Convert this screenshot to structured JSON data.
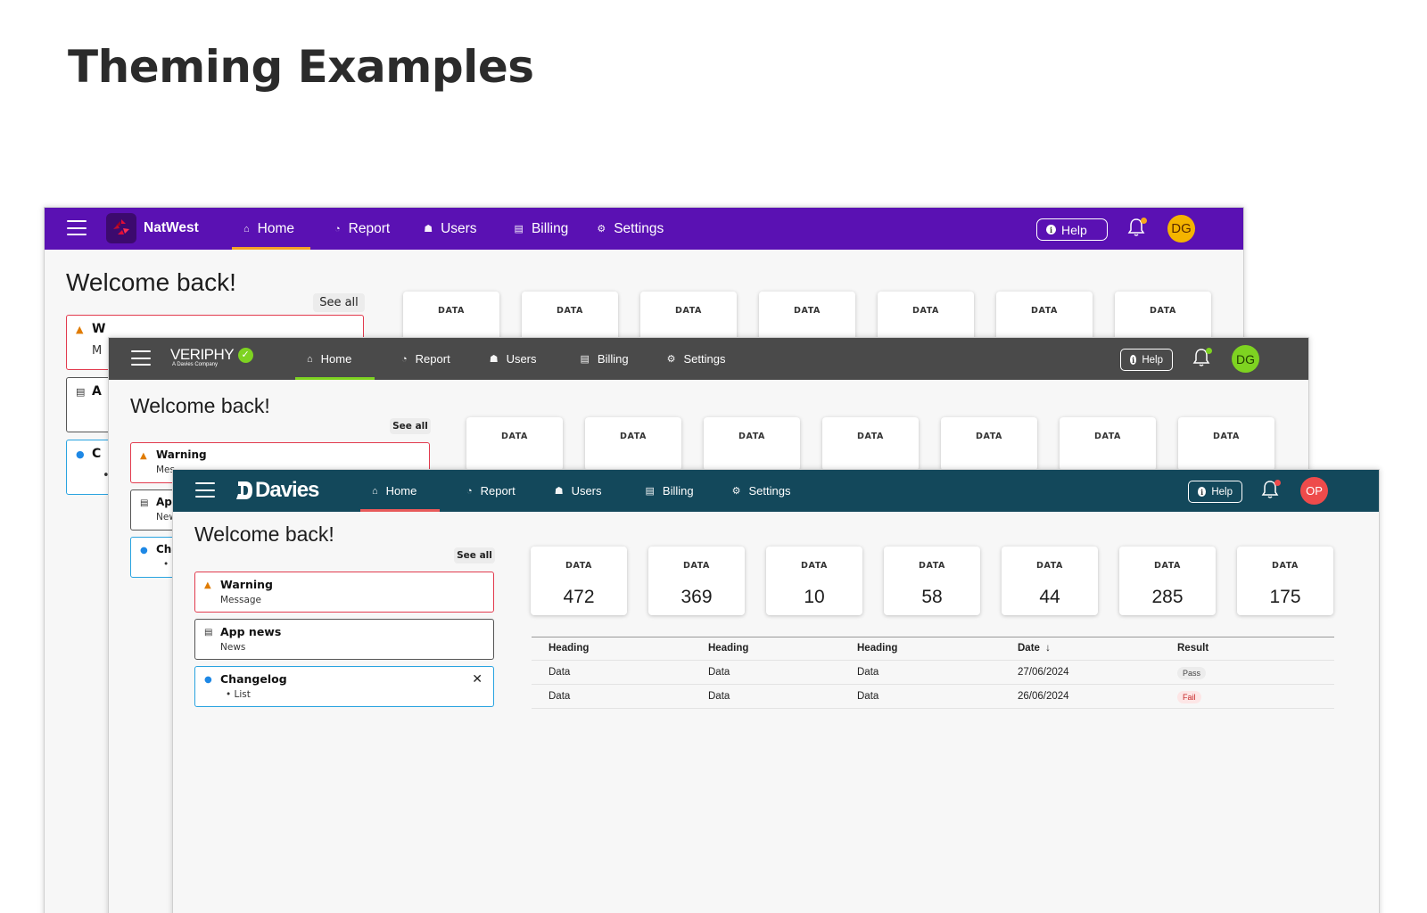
{
  "page": {
    "title": "Theming Examples"
  },
  "themes": {
    "natwest": {
      "brand_name": "NatWest",
      "colors": {
        "header": "#5a11b3",
        "accent": "#f4a228",
        "avatar": "#f4b400",
        "bell_dot": "#f7a81b"
      },
      "nav": [
        {
          "label": "Home",
          "icon": "home-icon",
          "glyph": "⌂"
        },
        {
          "label": "Report",
          "icon": "report-icon",
          "glyph": "◔"
        },
        {
          "label": "Users",
          "icon": "users-icon",
          "glyph": "☗"
        },
        {
          "label": "Billing",
          "icon": "billing-icon",
          "glyph": "▤"
        },
        {
          "label": "Settings",
          "icon": "settings-icon",
          "glyph": "⚙"
        }
      ],
      "help_label": "Help",
      "avatar_initials": "DG",
      "welcome": "Welcome back!",
      "see_all": "See all",
      "notices": [
        {
          "title": "W",
          "sub": "M"
        },
        {
          "title": "A"
        },
        {
          "title": "C",
          "sub": "•"
        }
      ],
      "cards": [
        "DATA",
        "DATA",
        "DATA",
        "DATA",
        "DATA",
        "DATA",
        "DATA"
      ]
    },
    "veriphy": {
      "brand_name": "VERIPHY",
      "brand_sub": "A Davies Company",
      "colors": {
        "header": "#4a4a4a",
        "accent": "#7ed321",
        "avatar": "#7ed321",
        "bell_dot": "#7ed321"
      },
      "nav": [
        {
          "label": "Home",
          "icon": "home-icon",
          "glyph": "⌂"
        },
        {
          "label": "Report",
          "icon": "report-icon",
          "glyph": "◔"
        },
        {
          "label": "Users",
          "icon": "users-icon",
          "glyph": "☗"
        },
        {
          "label": "Billing",
          "icon": "billing-icon",
          "glyph": "▤"
        },
        {
          "label": "Settings",
          "icon": "settings-icon",
          "glyph": "⚙"
        }
      ],
      "help_label": "Help",
      "avatar_initials": "DG",
      "welcome": "Welcome back!",
      "see_all": "See all",
      "notices": [
        {
          "title": "Warning",
          "sub": "Mes"
        },
        {
          "title": "App",
          "sub": "New"
        },
        {
          "title": "Cha",
          "sub": "•"
        }
      ],
      "cards": [
        "DATA",
        "DATA",
        "DATA",
        "DATA",
        "DATA",
        "DATA",
        "DATA"
      ]
    },
    "davies": {
      "brand_name": "Davies",
      "colors": {
        "header": "#13485b",
        "accent": "#e85a5a",
        "avatar": "#ee4b4b",
        "bell_dot": "#ee4b4b"
      },
      "nav": [
        {
          "label": "Home",
          "icon": "home-icon",
          "glyph": "⌂"
        },
        {
          "label": "Report",
          "icon": "report-icon",
          "glyph": "◔"
        },
        {
          "label": "Users",
          "icon": "users-icon",
          "glyph": "☗"
        },
        {
          "label": "Billing",
          "icon": "billing-icon",
          "glyph": "▤"
        },
        {
          "label": "Settings",
          "icon": "settings-icon",
          "glyph": "⚙"
        }
      ],
      "help_label": "Help",
      "avatar_initials": "OP",
      "welcome": "Welcome back!",
      "see_all": "See all",
      "notices": [
        {
          "title": "Warning",
          "sub": "Message",
          "icon": "warning-icon"
        },
        {
          "title": "App news",
          "sub": "News",
          "icon": "news-icon"
        },
        {
          "title": "Changelog",
          "sub": "• List",
          "icon": "info-icon"
        }
      ],
      "cards": [
        {
          "label": "DATA",
          "value": "472"
        },
        {
          "label": "DATA",
          "value": "369"
        },
        {
          "label": "DATA",
          "value": "10"
        },
        {
          "label": "DATA",
          "value": "58"
        },
        {
          "label": "DATA",
          "value": "44"
        },
        {
          "label": "DATA",
          "value": "285"
        },
        {
          "label": "DATA",
          "value": "175"
        }
      ],
      "table": {
        "headers": [
          "Heading",
          "Heading",
          "Heading",
          "Date",
          "Result"
        ],
        "sort_indicator": "↓",
        "rows": [
          {
            "cells": [
              "Data",
              "Data",
              "Data",
              "27/06/2024"
            ],
            "result": "Pass"
          },
          {
            "cells": [
              "Data",
              "Data",
              "Data",
              "26/06/2024"
            ],
            "result": "Fail"
          }
        ]
      }
    }
  }
}
